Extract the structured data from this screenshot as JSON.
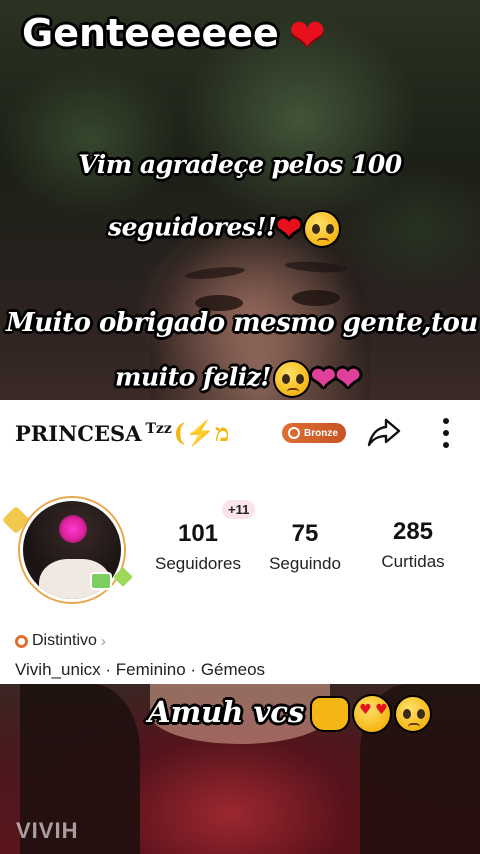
{
  "overlay": {
    "heading": "Genteeeeee",
    "line1": "Vim agradeçe pelos 100",
    "line2": "seguidores!!",
    "line3": "Muito obrigado mesmo gente,tou",
    "line4": "muito feliz!"
  },
  "profile": {
    "name": "PRINCESA",
    "name_suffix": "Tzz",
    "badge_label": "Bronze",
    "new_followers_badge": "+11",
    "stats": [
      {
        "value": "101",
        "label": "Seguidores"
      },
      {
        "value": "75",
        "label": "Seguindo"
      },
      {
        "value": "285",
        "label": "Curtidas"
      }
    ],
    "distintivo_label": "Distintivo",
    "info_line": "Vivih_unicx · Feminino · Gémeos"
  },
  "bottom_overlay": {
    "caption": "Amuh vcs",
    "watermark": "VIVIH"
  },
  "icons": {
    "heart": "heart-icon",
    "share": "share-icon",
    "more": "more-vertical-icon",
    "badge": "bronze-medal-icon",
    "distintivo": "distintivo-icon"
  },
  "colors": {
    "heart_red": "#e8101c",
    "badge_orange": "#e06e32",
    "new_followers_badge_bg": "#fbe3ec",
    "watermark": "#ffffff"
  }
}
